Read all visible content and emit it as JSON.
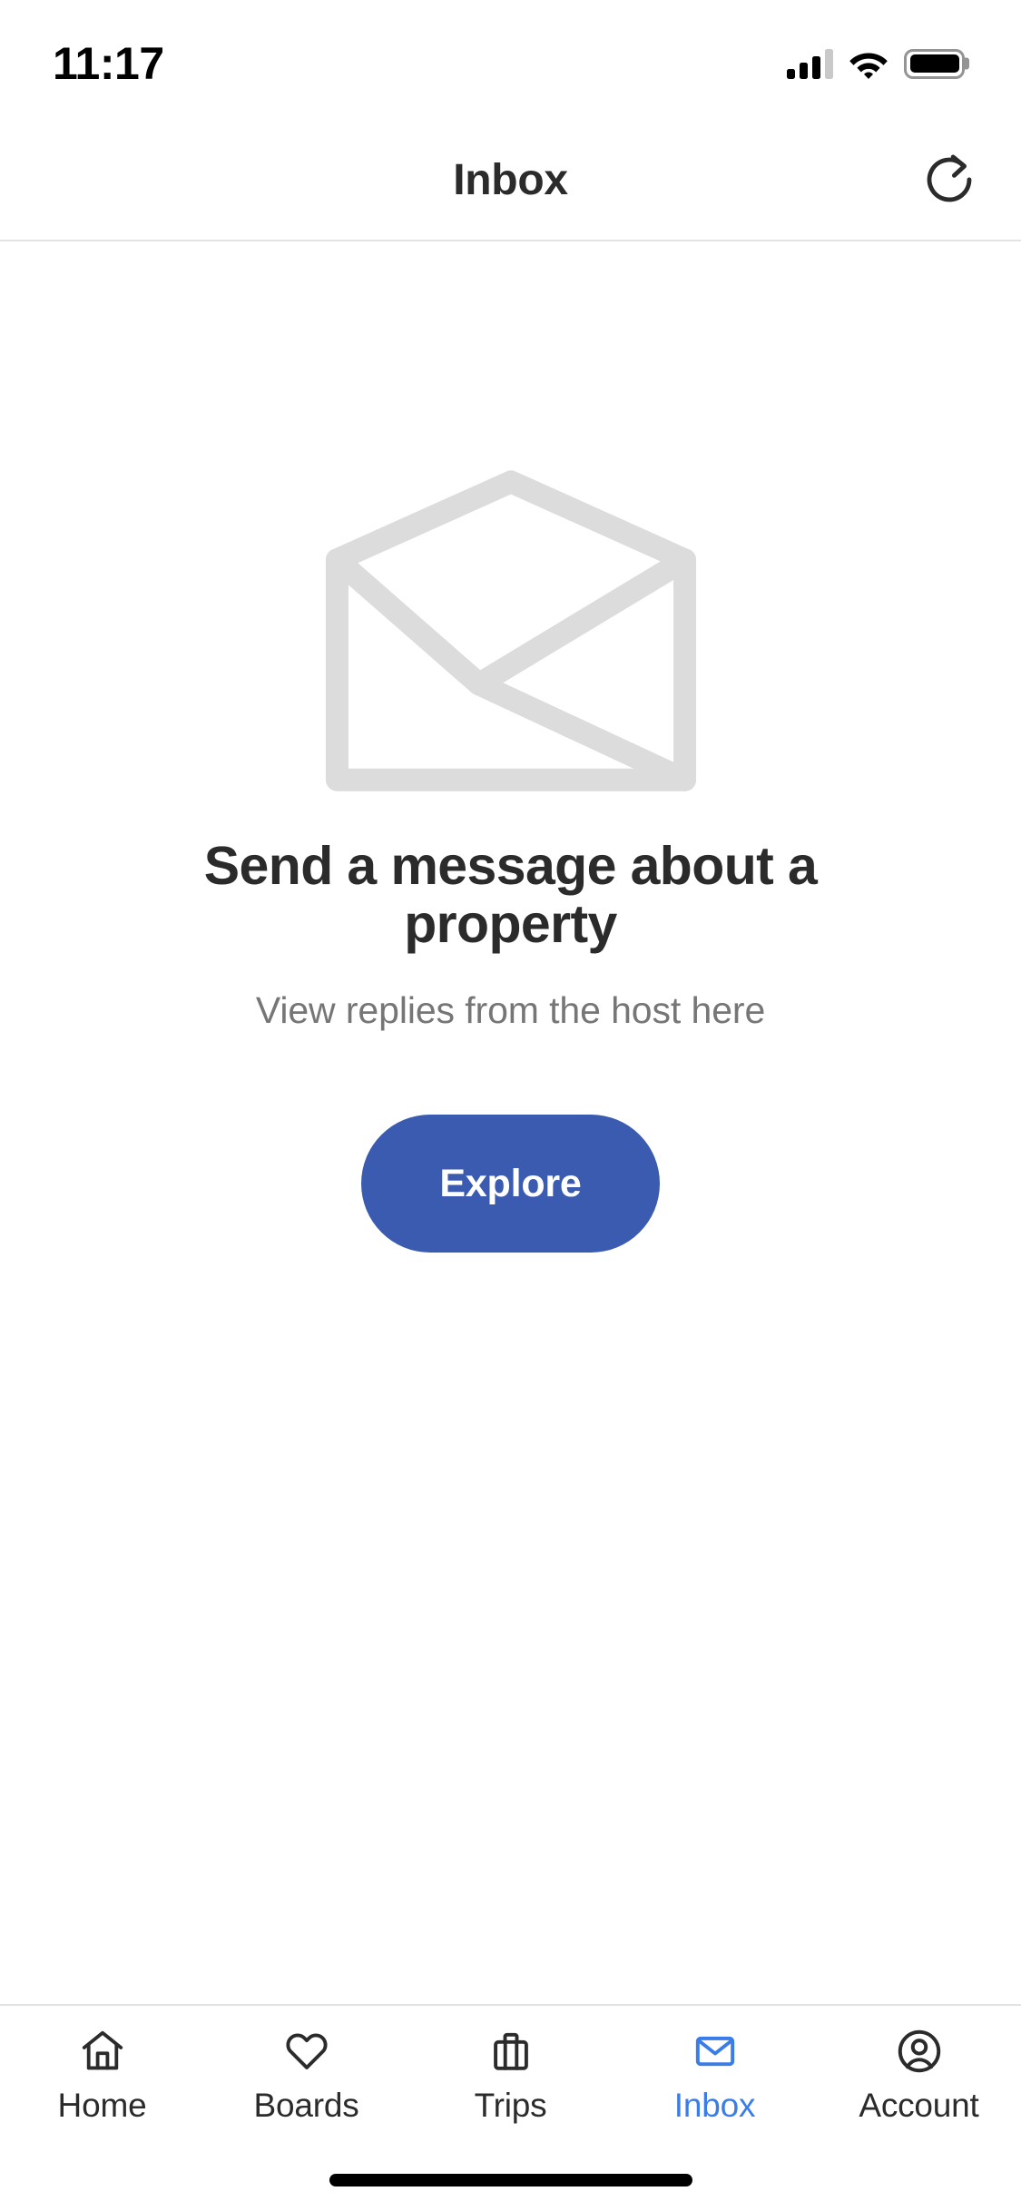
{
  "status_bar": {
    "time": "11:17",
    "signal_icon": "cellular-signal-icon",
    "signal_bars_total": 4,
    "signal_bars_filled": 3,
    "wifi_icon": "wifi-icon",
    "battery_icon": "battery-icon",
    "battery_level": "100"
  },
  "header": {
    "title": "Inbox",
    "refresh_icon": "refresh-icon"
  },
  "empty_state": {
    "illustration_icon": "open-envelope-icon",
    "illustration_color": "#dcdcdc",
    "title": "Send a message about a property",
    "subtitle": "View replies from the host here",
    "cta_label": "Explore",
    "cta_color": "#3a5bb0",
    "cta_text_color": "#ffffff"
  },
  "bottom_nav": {
    "active_color": "#3b7de8",
    "inactive_color": "#2b2b2b",
    "items": [
      {
        "label": "Home",
        "icon": "house-icon",
        "active": false
      },
      {
        "label": "Boards",
        "icon": "heart-icon",
        "active": false
      },
      {
        "label": "Trips",
        "icon": "suitcase-icon",
        "active": false
      },
      {
        "label": "Inbox",
        "icon": "envelope-icon",
        "active": true
      },
      {
        "label": "Account",
        "icon": "person-circle-icon",
        "active": false
      }
    ]
  },
  "home_indicator": {
    "name": "home-indicator-bar"
  }
}
